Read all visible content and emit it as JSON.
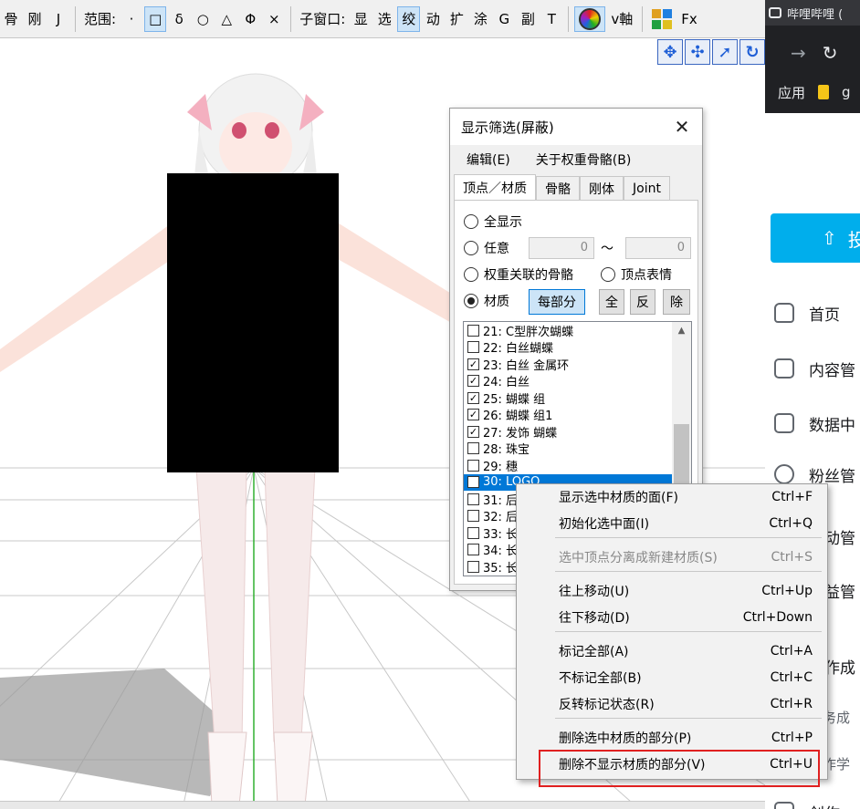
{
  "toolbar": {
    "items": [
      "骨",
      "刚",
      "J",
      "范围:",
      "·",
      "□",
      "δ",
      "○",
      "△",
      "Φ",
      "×",
      "子窗口:",
      "显",
      "选",
      "绞",
      "动",
      "扩",
      "涂",
      "G",
      "副",
      "T",
      "v軸",
      "Fx"
    ]
  },
  "browser": {
    "tab_title": "哔哩哔哩 (",
    "bookmark_label": "应用",
    "bookmark_tail": "g"
  },
  "sidebar": {
    "upload_label": "投",
    "items": [
      "首页",
      "内容管",
      "数据中",
      "粉丝管",
      "互动管",
      "收益管",
      "创作成",
      "任务成",
      "创作学",
      "创作"
    ]
  },
  "dialog": {
    "title": "显示筛选(屏蔽)",
    "menu": [
      "编辑(E)",
      "关于权重骨骼(B)"
    ],
    "tabs": [
      "顶点／材质",
      "骨骼",
      "刚体",
      "Joint"
    ],
    "radio_all": "全显示",
    "radio_any": "任意",
    "range_from": "0",
    "range_sep": "〜",
    "range_to": "0",
    "radio_weight_bone": "权重关联的骨骼",
    "radio_vertex_morph": "顶点表情",
    "radio_material": "材质",
    "btn_each_part": "每部分",
    "btn_all": "全",
    "btn_invert": "反",
    "btn_remove": "除",
    "materials": [
      {
        "label": "21: C型胖次蝴蝶",
        "checked": false
      },
      {
        "label": "22: 白丝蝴蝶",
        "checked": false
      },
      {
        "label": "23: 白丝 金属环",
        "checked": true
      },
      {
        "label": "24: 白丝",
        "checked": true
      },
      {
        "label": "25: 蝴蝶 组",
        "checked": true
      },
      {
        "label": "26: 蝴蝶 组1",
        "checked": true
      },
      {
        "label": "27: 发饰 蝴蝶",
        "checked": true
      },
      {
        "label": "28: 珠宝",
        "checked": false
      },
      {
        "label": "29: 穗",
        "checked": false
      },
      {
        "label": "30: LOGO",
        "checked": false,
        "selected": true
      },
      {
        "label": "31: 后",
        "checked": false
      },
      {
        "label": "32: 后",
        "checked": false
      },
      {
        "label": "33: 长",
        "checked": false
      },
      {
        "label": "34: 长",
        "checked": false
      },
      {
        "label": "35: 长",
        "checked": false
      }
    ]
  },
  "context_menu": {
    "items": [
      {
        "label": "显示选中材质的面(F)",
        "shortcut": "Ctrl+F"
      },
      {
        "label": "初始化选中面(I)",
        "shortcut": "Ctrl+Q"
      },
      {
        "label": "选中顶点分离成新建材质(S)",
        "shortcut": "Ctrl+S",
        "disabled": true
      },
      {
        "label": "往上移动(U)",
        "shortcut": "Ctrl+Up"
      },
      {
        "label": "往下移动(D)",
        "shortcut": "Ctrl+Down"
      },
      {
        "label": "标记全部(A)",
        "shortcut": "Ctrl+A"
      },
      {
        "label": "不标记全部(B)",
        "shortcut": "Ctrl+C"
      },
      {
        "label": "反转标记状态(R)",
        "shortcut": "Ctrl+R"
      },
      {
        "label": "删除选中材质的部分(P)",
        "shortcut": "Ctrl+P"
      },
      {
        "label": "删除不显示材质的部分(V)",
        "shortcut": "Ctrl+U",
        "highlighted": true
      }
    ]
  },
  "colors": {
    "accent_blue": "#0078d7",
    "bilibili_blue": "#00aeec",
    "highlight_red": "#e02020"
  }
}
